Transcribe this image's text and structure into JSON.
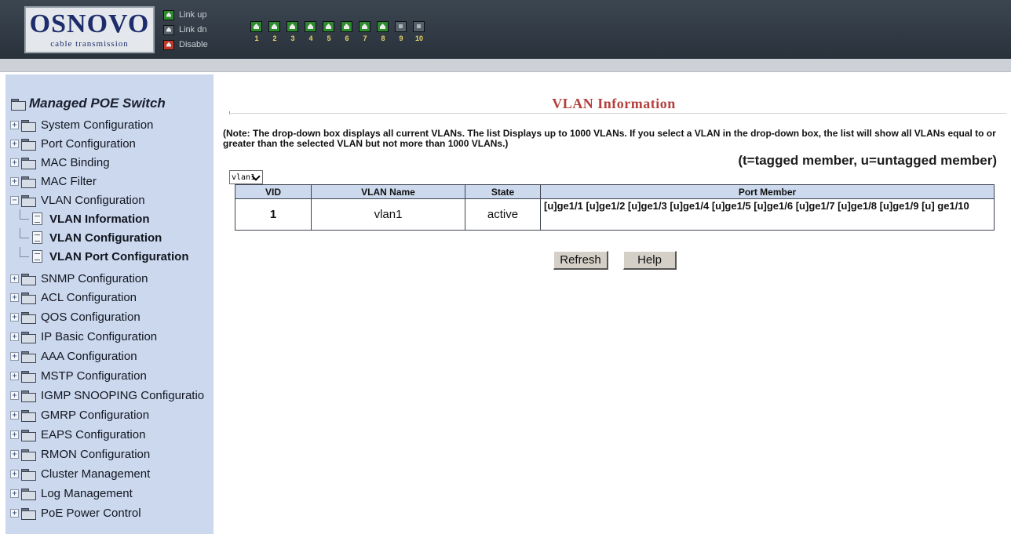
{
  "header": {
    "logo_word": "OSNOVO",
    "logo_sub": "cable transmission",
    "legend": [
      {
        "label": "Link up",
        "color": "#2d8a2d"
      },
      {
        "label": "Link dn",
        "color": "#55606a"
      },
      {
        "label": "Disable",
        "color": "#c0392b"
      }
    ],
    "ports": [
      {
        "number": "1",
        "state": "up"
      },
      {
        "number": "2",
        "state": "up"
      },
      {
        "number": "3",
        "state": "up"
      },
      {
        "number": "4",
        "state": "up"
      },
      {
        "number": "5",
        "state": "up"
      },
      {
        "number": "6",
        "state": "up"
      },
      {
        "number": "7",
        "state": "up"
      },
      {
        "number": "8",
        "state": "up"
      },
      {
        "number": "9",
        "state": "down"
      },
      {
        "number": "10",
        "state": "down"
      }
    ]
  },
  "sidebar": {
    "title": "Managed POE Switch",
    "items": [
      {
        "label": "System Configuration",
        "expanded": false
      },
      {
        "label": "Port Configuration",
        "expanded": false
      },
      {
        "label": "MAC Binding",
        "expanded": false
      },
      {
        "label": "MAC Filter",
        "expanded": false
      },
      {
        "label": "VLAN Configuration",
        "expanded": true
      }
    ],
    "vlan_children": [
      {
        "label": "VLAN Information"
      },
      {
        "label": "VLAN Configuration"
      },
      {
        "label": "VLAN Port Configuration"
      }
    ],
    "items_after": [
      {
        "label": "SNMP Configuration"
      },
      {
        "label": "ACL Configuration"
      },
      {
        "label": "QOS Configuration"
      },
      {
        "label": "IP Basic Configuration"
      },
      {
        "label": "AAA Configuration"
      },
      {
        "label": "MSTP Configuration"
      },
      {
        "label": "IGMP SNOOPING Configuratio"
      },
      {
        "label": "GMRP Configuration"
      },
      {
        "label": "EAPS Configuration"
      },
      {
        "label": "RMON Configuration"
      },
      {
        "label": "Cluster Management"
      },
      {
        "label": "Log Management"
      },
      {
        "label": "PoE Power Control"
      }
    ]
  },
  "main": {
    "title": "VLAN Information",
    "note": "(Note: The drop-down box displays all current VLANs. The list Displays up to 1000 VLANs. If you select a VLAN in the drop-down box, the list will show all VLANs equal to or greater than the selected VLAN but not more than 1000 VLANs.)",
    "legend": "(t=tagged member, u=untagged member)",
    "select_value": "vlan1",
    "table": {
      "headers": [
        "VID",
        "VLAN Name",
        "State",
        "Port Member"
      ],
      "rows": [
        {
          "vid": "1",
          "name": "vlan1",
          "state": "active",
          "ports": "[u]ge1/1 [u]ge1/2 [u]ge1/3 [u]ge1/4 [u]ge1/5 [u]ge1/6 [u]ge1/7 [u]ge1/8 [u]ge1/9 [u] ge1/10"
        }
      ]
    },
    "buttons": {
      "refresh": "Refresh",
      "help": "Help"
    }
  }
}
